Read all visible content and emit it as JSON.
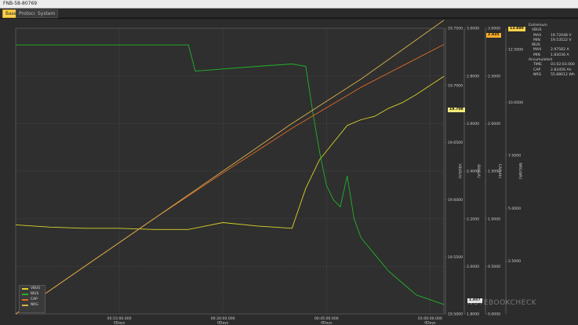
{
  "window": {
    "title": "FNB-58-80769"
  },
  "tabs": [
    {
      "label": "Base",
      "active": true
    },
    {
      "label": "Protocol",
      "active": false
    },
    {
      "label": "System",
      "active": false
    }
  ],
  "panel": {
    "extremum_label": "Extremum",
    "vbus_label": "VBUS",
    "vbus_max_key": "MAX",
    "vbus_max": "19.72048 V",
    "vbus_min_key": "MIN",
    "vbus_min": "19.53522 V",
    "ibus_label": "IBUS",
    "ibus_max_key": "MAX",
    "ibus_max": "2.97582 A",
    "ibus_min_key": "MIN",
    "ibus_min": "1.83036 A",
    "accum_label": "Accumulated",
    "time_key": "TIME",
    "time": "01:02:03.000",
    "cap_key": "CAP",
    "cap": "2.83456 Ah",
    "nrg_key": "NRG",
    "nrg": "55.88012 Wh"
  },
  "flags": {
    "ibus_flag": "2.835",
    "cap_flag": "13.880",
    "vbus_flag": "19.708",
    "low_flag": "1.847"
  },
  "legend": [
    "VBUS",
    "IBUS",
    "CAP",
    "NRG"
  ],
  "watermark": "NOTEBOOKCHECK",
  "chart_data": {
    "type": "line",
    "x_ticks": [
      {
        "time": "00:15:00.000",
        "day": "0Days"
      },
      {
        "time": "00:30:00.000",
        "day": "0Days"
      },
      {
        "time": "00:45:00.000",
        "day": "0Days"
      },
      {
        "time": "01:00:00.000",
        "day": "0Days"
      }
    ],
    "axes": [
      {
        "id": "vbus",
        "label": "VBUS(V)",
        "ylim": [
          19.5,
          19.75
        ],
        "ticks": [
          "19.5000",
          "19.5500",
          "19.6000",
          "19.6500",
          "19.7000",
          "19.7500"
        ]
      },
      {
        "id": "ibus",
        "label": "IBUS(A)",
        "ylim": [
          1.8,
          3.0
        ],
        "ticks": [
          "1.8000",
          "2.0000",
          "2.2000",
          "2.4000",
          "2.6000",
          "2.8000",
          "3.0000"
        ]
      },
      {
        "id": "cap",
        "label": "CAP(Ah)",
        "ylim": [
          0,
          3.0
        ],
        "ticks": [
          "0.0000",
          "0.5000",
          "1.0000",
          "1.5000",
          "2.0000",
          "2.5000",
          "3.0000"
        ]
      },
      {
        "id": "nrg",
        "label": "NRG(Wh)",
        "ylim": [
          0,
          13.5
        ],
        "ticks": [
          "2.5000",
          "5.0000",
          "7.5000",
          "10.0000",
          "12.5000"
        ]
      }
    ],
    "x_minutes_range": [
      0,
      62
    ],
    "series": [
      {
        "name": "VBUS",
        "color": "#d8d32a",
        "axis": "vbus",
        "x": [
          0,
          5,
          10,
          15,
          20,
          25,
          30,
          35,
          40,
          42,
          44,
          46,
          48,
          50,
          52,
          54,
          56,
          58,
          60,
          62
        ],
        "y": [
          19.578,
          19.576,
          19.575,
          19.575,
          19.574,
          19.574,
          19.58,
          19.577,
          19.575,
          19.61,
          19.635,
          19.65,
          19.665,
          19.67,
          19.673,
          19.68,
          19.685,
          19.692,
          19.7,
          19.708
        ]
      },
      {
        "name": "IBUS",
        "color": "#22b327",
        "axis": "ibus",
        "x": [
          0,
          10,
          20,
          25,
          26,
          35,
          40,
          42,
          43,
          44,
          45,
          46,
          47,
          48,
          49,
          50,
          52,
          54,
          56,
          58,
          60,
          62
        ],
        "y": [
          2.93,
          2.93,
          2.93,
          2.93,
          2.82,
          2.84,
          2.85,
          2.84,
          2.65,
          2.48,
          2.34,
          2.28,
          2.25,
          2.38,
          2.2,
          2.12,
          2.05,
          1.98,
          1.93,
          1.88,
          1.86,
          1.84
        ]
      },
      {
        "name": "CAP",
        "color": "#e06a28",
        "axis": "cap",
        "x": [
          0,
          10,
          20,
          30,
          40,
          50,
          62
        ],
        "y": [
          0.0,
          0.5,
          1.0,
          1.48,
          1.95,
          2.38,
          2.83
        ]
      },
      {
        "name": "NRG",
        "color": "#d9b04a",
        "axis": "nrg",
        "x": [
          0,
          10,
          20,
          30,
          40,
          50,
          62
        ],
        "y": [
          0.0,
          2.25,
          4.5,
          6.75,
          9.0,
          11.1,
          13.88
        ]
      }
    ]
  }
}
